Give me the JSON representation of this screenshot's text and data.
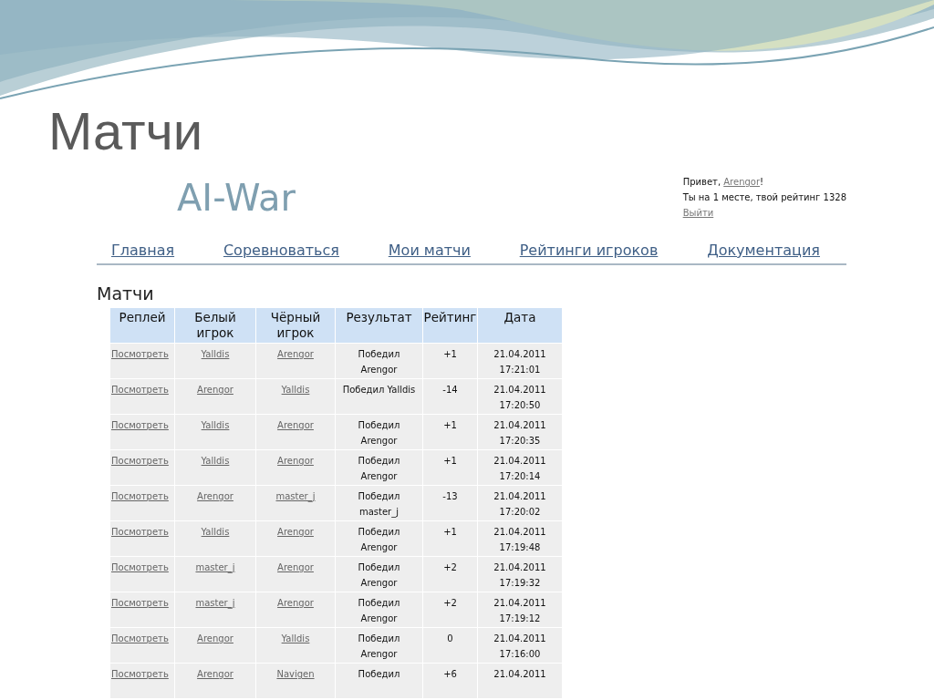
{
  "slide": {
    "title": "Матчи"
  },
  "site": {
    "logo": "AI-War",
    "user": {
      "greeting": "Привет, ",
      "name": "Arengor",
      "greeting_end": "!",
      "place": "Ты на 1 месте, твой рейтинг 1328",
      "logout": "Выйти"
    },
    "nav": [
      "Главная",
      "Соревноваться",
      "Мои матчи",
      "Рейтинги игроков",
      "Документация"
    ],
    "heading": "Матчи",
    "table": {
      "columns": [
        "Реплей",
        "Белый\nигрок",
        "Чёрный\nигрок",
        "Результат",
        "Рейтинг",
        "Дата"
      ],
      "rows": [
        {
          "replay": "Посмотреть",
          "white": "Yalldis",
          "black": "Arengor",
          "result": "Победил\nArengor",
          "rating": "+1",
          "date": "21.04.2011\n17:21:01"
        },
        {
          "replay": "Посмотреть",
          "white": "Arengor",
          "black": "Yalldis",
          "result": "Победил Yalldis",
          "rating": "-14",
          "date": "21.04.2011\n17:20:50"
        },
        {
          "replay": "Посмотреть",
          "white": "Yalldis",
          "black": "Arengor",
          "result": "Победил\nArengor",
          "rating": "+1",
          "date": "21.04.2011\n17:20:35"
        },
        {
          "replay": "Посмотреть",
          "white": "Yalldis",
          "black": "Arengor",
          "result": "Победил\nArengor",
          "rating": "+1",
          "date": "21.04.2011\n17:20:14"
        },
        {
          "replay": "Посмотреть",
          "white": "Arengor",
          "black": "master_j",
          "result": "Победил\nmaster_j",
          "rating": "-13",
          "date": "21.04.2011\n17:20:02"
        },
        {
          "replay": "Посмотреть",
          "white": "Yalldis",
          "black": "Arengor",
          "result": "Победил\nArengor",
          "rating": "+1",
          "date": "21.04.2011\n17:19:48"
        },
        {
          "replay": "Посмотреть",
          "white": "master_j",
          "black": "Arengor",
          "result": "Победил\nArengor",
          "rating": "+2",
          "date": "21.04.2011\n17:19:32"
        },
        {
          "replay": "Посмотреть",
          "white": "master_j",
          "black": "Arengor",
          "result": "Победил\nArengor",
          "rating": "+2",
          "date": "21.04.2011\n17:19:12"
        },
        {
          "replay": "Посмотреть",
          "white": "Arengor",
          "black": "Yalldis",
          "result": "Победил\nArengor",
          "rating": "0",
          "date": "21.04.2011\n17:16:00"
        },
        {
          "replay": "Посмотреть",
          "white": "Arengor",
          "black": "Navigen",
          "result": "Победил",
          "rating": "+6",
          "date": "21.04.2011"
        }
      ]
    }
  }
}
